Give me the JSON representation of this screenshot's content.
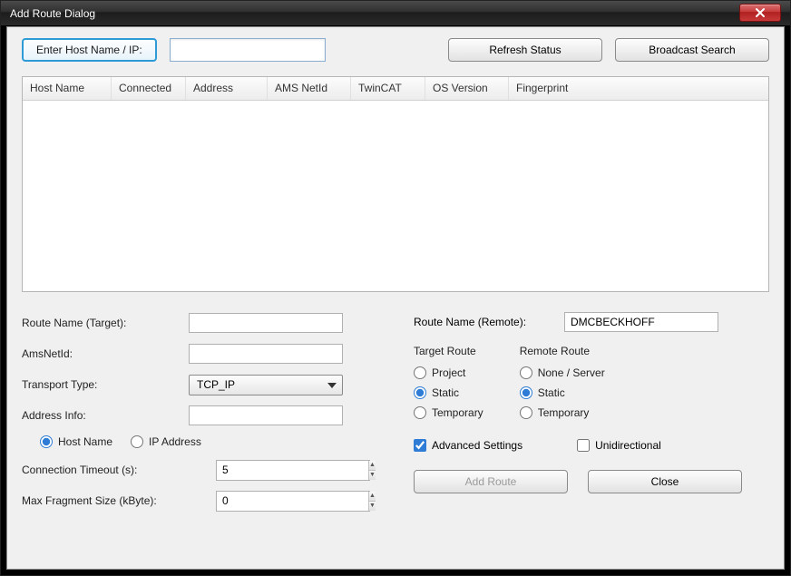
{
  "window": {
    "title": "Add Route Dialog"
  },
  "top": {
    "enter_host_btn": "Enter Host Name / IP:",
    "host_value": "",
    "refresh_btn": "Refresh Status",
    "broadcast_btn": "Broadcast Search"
  },
  "grid": {
    "columns": [
      "Host Name",
      "Connected",
      "Address",
      "AMS NetId",
      "TwinCAT",
      "OS Version",
      "Fingerprint"
    ]
  },
  "left": {
    "route_name_target_label": "Route Name (Target):",
    "route_name_target_value": "",
    "ams_netid_label": "AmsNetId:",
    "ams_netid_value": "",
    "transport_label": "Transport Type:",
    "transport_value": "TCP_IP",
    "address_info_label": "Address Info:",
    "address_info_value": "",
    "addr_radio_host": "Host Name",
    "addr_radio_ip": "IP Address",
    "conn_timeout_label": "Connection Timeout (s):",
    "conn_timeout_value": "5",
    "max_frag_label": "Max Fragment Size (kByte):",
    "max_frag_value": "0"
  },
  "right": {
    "route_name_remote_label": "Route Name (Remote):",
    "route_name_remote_value": "DMCBECKHOFF",
    "target_route_title": "Target Route",
    "remote_route_title": "Remote Route",
    "opt_project": "Project",
    "opt_static": "Static",
    "opt_temporary": "Temporary",
    "opt_none_server": "None / Server",
    "advanced_settings": "Advanced Settings",
    "unidirectional": "Unidirectional",
    "add_route_btn": "Add Route",
    "close_btn": "Close"
  }
}
